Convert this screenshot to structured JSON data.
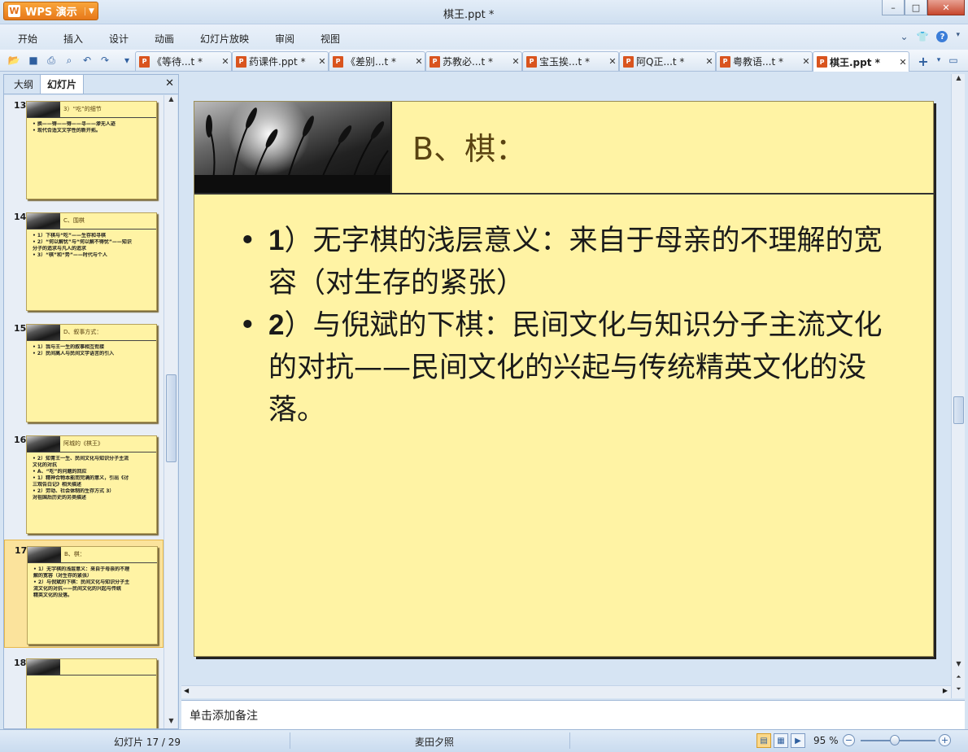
{
  "window": {
    "app_button": "WPS 演示",
    "title": "棋王.ppt *",
    "controls": {
      "minimize": "–",
      "maximize": "□",
      "close": "✕"
    }
  },
  "menu": {
    "items": [
      "开始",
      "插入",
      "设计",
      "动画",
      "幻灯片放映",
      "审阅",
      "视图"
    ]
  },
  "tabs": [
    {
      "label": "《等待...t *",
      "close": "✕"
    },
    {
      "label": "药课件.ppt *",
      "close": "✕"
    },
    {
      "label": "《差别...t *",
      "close": "✕"
    },
    {
      "label": "苏教必...t *",
      "close": "✕"
    },
    {
      "label": "宝玉挨...t *",
      "close": "✕"
    },
    {
      "label": "阿Q正...t *",
      "close": "✕"
    },
    {
      "label": "粤教语...t *",
      "close": "✕"
    },
    {
      "label": "棋王.ppt *",
      "close": "✕"
    }
  ],
  "sidebar": {
    "tabs": [
      "大纲",
      "幻灯片"
    ],
    "active_tab": "幻灯片",
    "slides": [
      {
        "num": "13",
        "head": "3）“吃”的细节",
        "lines": [
          "• 换——得——得——寻——渗无人迹",
          "• 现代合适文文学性的新开拓。"
        ]
      },
      {
        "num": "14",
        "head": "C、围棋",
        "lines": [
          "• 1）下棋与“吃”——生存和寻棋",
          "• 2）“何以解忧”与“何以解不得忧”——知识",
          "  分子的追求与凡人的追求",
          "• 3）“棋”和“势”——时代与个人"
        ]
      },
      {
        "num": "15",
        "head": "D、叙事方式：",
        "lines": [
          "• 1）我与王一生的叙事相互衔接",
          "• 2）民间高人与民间文学语言的引入"
        ]
      },
      {
        "num": "16",
        "head": "阿城的《棋王》",
        "lines": [
          "• 2）知青王一生、民间文化与知识分子主流",
          "  文化的对抗",
          "• A、“吃”的问题的回应",
          "• 1）精神合物本能而完满的意义，引出《讨",
          "  三观告白记》相关描述",
          "• 2）劳动、社会体制的生存方式       3）",
          "  对祖国后历史的另类描述"
        ]
      },
      {
        "num": "17",
        "head": "B、棋：",
        "lines": [
          "• 1）无字棋的浅层意义：来自于母亲的不理",
          "  解的宽容（对生存的紧张）",
          "• 2）与倪斌的下棋：民间文化与知识分子主",
          "  流文化的对抗——民间文化的兴起与传统",
          "  精英文化的没落。"
        ]
      },
      {
        "num": "18",
        "head": "",
        "lines": []
      }
    ]
  },
  "slide": {
    "title": "B、棋：",
    "bullets": [
      {
        "num": "1",
        "text": "）无字棋的浅层意义：来自于母亲的不理解的宽容（对生存的紧张）"
      },
      {
        "num": "2",
        "text": "）与倪斌的下棋：民间文化与知识分子主流文化的对抗——民间文化的兴起与传统精英文化的没落。"
      }
    ],
    "bullet_symbol": "•"
  },
  "notes_placeholder": "单击添加备注",
  "status": {
    "slide_counter": "幻灯片 17 / 29",
    "theme": "麦田夕照",
    "zoom": "95 %"
  },
  "colors": {
    "slide_bg": "#fff3a4",
    "title_color": "#5a4312",
    "accent": "#e7781a"
  }
}
